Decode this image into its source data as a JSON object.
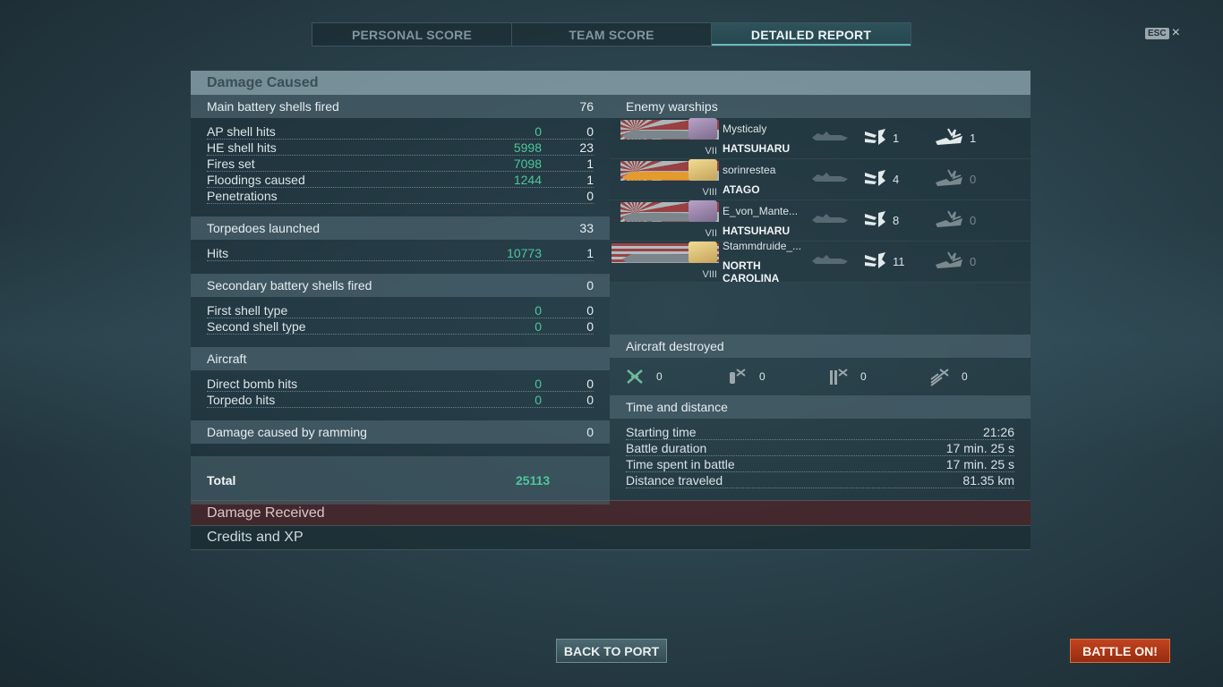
{
  "tabs": [
    {
      "label": "PERSONAL SCORE"
    },
    {
      "label": "TEAM SCORE"
    },
    {
      "label": "DETAILED REPORT"
    }
  ],
  "esc": {
    "key": "ESC",
    "close": "×"
  },
  "damage_caused": {
    "title": "Damage Caused",
    "main_battery": {
      "label": "Main battery shells fired",
      "value": "76",
      "rows": [
        {
          "label": "AP shell hits",
          "damage": "0",
          "count": "0"
        },
        {
          "label": "HE shell hits",
          "damage": "5998",
          "count": "23"
        },
        {
          "label": "Fires set",
          "damage": "7098",
          "count": "1"
        },
        {
          "label": "Floodings caused",
          "damage": "1244",
          "count": "1"
        },
        {
          "label": "Penetrations",
          "damage": "",
          "count": "0"
        }
      ]
    },
    "torpedoes": {
      "label": "Torpedoes launched",
      "value": "33",
      "rows": [
        {
          "label": "Hits",
          "damage": "10773",
          "count": "1"
        }
      ]
    },
    "secondary": {
      "label": "Secondary battery shells fired",
      "value": "0",
      "rows": [
        {
          "label": "First shell type",
          "damage": "0",
          "count": "0"
        },
        {
          "label": "Second shell type",
          "damage": "0",
          "count": "0"
        }
      ]
    },
    "aircraft": {
      "label": "Aircraft",
      "rows": [
        {
          "label": "Direct bomb hits",
          "damage": "0",
          "count": "0"
        },
        {
          "label": "Torpedo hits",
          "damage": "0",
          "count": "0"
        }
      ]
    },
    "ramming": {
      "label": "Damage caused by ramming",
      "value": "0"
    },
    "total": {
      "label": "Total",
      "value": "25113"
    }
  },
  "enemy_warships": {
    "title": "Enemy warships",
    "ships": [
      {
        "player": "Mysticaly",
        "ship": "HATSUHARU",
        "tier": "VII",
        "nation": "jp",
        "hits": "1",
        "hits_dim": false,
        "kills": "1",
        "kills_dim": false
      },
      {
        "player": "sorinrestea",
        "ship": "ATAGO",
        "tier": "VIII",
        "nation": "jp",
        "hits": "4",
        "hits_dim": false,
        "kills": "0",
        "kills_dim": true
      },
      {
        "player": "E_von_Mante...",
        "ship": "HATSUHARU",
        "tier": "VII",
        "nation": "jp",
        "hits": "8",
        "hits_dim": false,
        "kills": "0",
        "kills_dim": true
      },
      {
        "player": "Stammdruide_...",
        "ship": "NORTH CAROLINA",
        "tier": "VIII",
        "nation": "us",
        "hits": "11",
        "hits_dim": false,
        "kills": "0",
        "kills_dim": true
      }
    ]
  },
  "aircraft_destroyed": {
    "title": "Aircraft destroyed",
    "items": [
      {
        "icon": "fighter-crossed-icon",
        "value": "0"
      },
      {
        "icon": "dive-bomber-icon",
        "value": "0"
      },
      {
        "icon": "torpedo-bomber-icon",
        "value": "0"
      },
      {
        "icon": "catapult-plane-icon",
        "value": "0"
      }
    ]
  },
  "time_distance": {
    "title": "Time and distance",
    "rows": [
      {
        "label": "Starting time",
        "value": "21:26"
      },
      {
        "label": "Battle duration",
        "value": "17 min. 25 s"
      },
      {
        "label": "Time spent in battle",
        "value": "17 min. 25 s"
      },
      {
        "label": "Distance traveled",
        "value": "81.35 km"
      }
    ]
  },
  "collapsed": {
    "damage_received": "Damage Received",
    "credits_xp": "Credits and XP"
  },
  "buttons": {
    "back_to_port": "BACK TO PORT",
    "battle_on": "BATTLE ON!"
  },
  "colors": {
    "accent_green": "#4cc79c",
    "battle_button": "#c2431e",
    "damage_received_bg": "#482428"
  }
}
